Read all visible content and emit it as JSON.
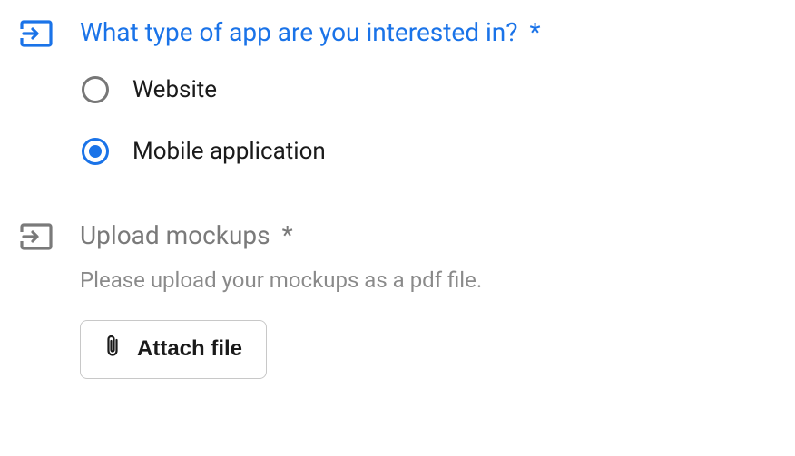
{
  "question1": {
    "title": "What type of app are you interested in?",
    "required_mark": "*",
    "options": [
      {
        "label": "Website",
        "selected": false
      },
      {
        "label": "Mobile application",
        "selected": true
      }
    ]
  },
  "question2": {
    "title": "Upload mockups",
    "required_mark": "*",
    "helper": "Please upload your mockups as a pdf file.",
    "attach_label": "Attach file"
  },
  "colors": {
    "accent": "#1a73e8",
    "muted": "#7a7a7a"
  }
}
